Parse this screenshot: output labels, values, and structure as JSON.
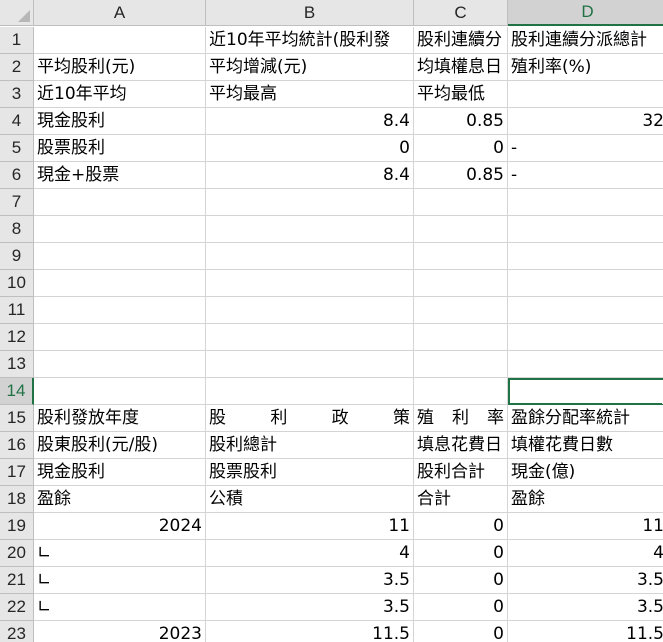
{
  "spreadsheet": {
    "columns": [
      "A",
      "B",
      "C",
      "D"
    ],
    "selected_column": "D",
    "selected_row": 14,
    "active_cell": "D14",
    "rows": [
      {
        "n": "1",
        "cells": [
          "",
          "近10年平均統計(股利發",
          "股利連續分",
          "股利連續分派總計"
        ]
      },
      {
        "n": "2",
        "cells": [
          "平均股利(元)",
          "平均增減(元)",
          "均填權息日",
          "殖利率(%)"
        ]
      },
      {
        "n": "3",
        "cells": [
          "近10年平均",
          "平均最高",
          "平均最低",
          ""
        ]
      },
      {
        "n": "4",
        "cells": [
          "現金股利",
          "8.4",
          "0.85",
          "32"
        ]
      },
      {
        "n": "5",
        "cells": [
          "股票股利",
          "0",
          "0",
          "-"
        ]
      },
      {
        "n": "6",
        "cells": [
          "現金+股票",
          "8.4",
          "0.85",
          "-"
        ]
      },
      {
        "n": "7",
        "cells": [
          "",
          "",
          "",
          ""
        ]
      },
      {
        "n": "8",
        "cells": [
          "",
          "",
          "",
          ""
        ]
      },
      {
        "n": "9",
        "cells": [
          "",
          "",
          "",
          ""
        ]
      },
      {
        "n": "10",
        "cells": [
          "",
          "",
          "",
          ""
        ]
      },
      {
        "n": "11",
        "cells": [
          "",
          "",
          "",
          ""
        ]
      },
      {
        "n": "12",
        "cells": [
          "",
          "",
          "",
          ""
        ]
      },
      {
        "n": "13",
        "cells": [
          "",
          "",
          "",
          ""
        ]
      },
      {
        "n": "14",
        "cells": [
          "",
          "",
          "",
          ""
        ]
      },
      {
        "n": "15",
        "cells": [
          "股利發放年度",
          "股利政策",
          "殖利率",
          "盈餘分配率統計"
        ]
      },
      {
        "n": "16",
        "cells": [
          "股東股利(元/股)",
          "股利總計",
          "填息花費日",
          "填權花費日數"
        ]
      },
      {
        "n": "17",
        "cells": [
          "現金股利",
          "股票股利",
          "股利合計",
          "現金(億)"
        ]
      },
      {
        "n": "18",
        "cells": [
          "盈餘",
          "公積",
          "合計",
          "盈餘"
        ]
      },
      {
        "n": "19",
        "cells": [
          "2024",
          "11",
          "0",
          "11"
        ]
      },
      {
        "n": "20",
        "cells": [
          "∟",
          "4",
          "0",
          "4"
        ]
      },
      {
        "n": "21",
        "cells": [
          "∟",
          "3.5",
          "0",
          "3.5"
        ]
      },
      {
        "n": "22",
        "cells": [
          "∟",
          "3.5",
          "0",
          "3.5"
        ]
      },
      {
        "n": "23",
        "cells": [
          "2023",
          "11.5",
          "0",
          "11.5"
        ]
      }
    ]
  }
}
